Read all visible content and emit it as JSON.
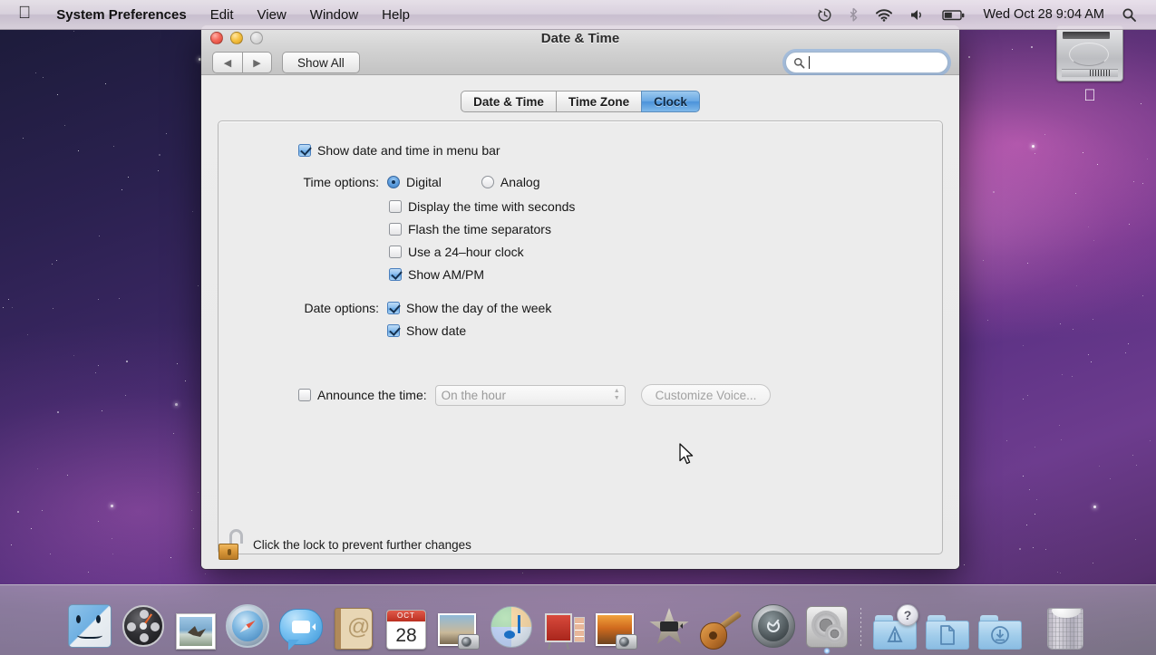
{
  "menubar": {
    "apple_icon": "apple-logo-icon",
    "items": [
      {
        "label": "System Preferences",
        "bold": true
      },
      {
        "label": "Edit",
        "bold": false
      },
      {
        "label": "View",
        "bold": false
      },
      {
        "label": "Window",
        "bold": false
      },
      {
        "label": "Help",
        "bold": false
      }
    ],
    "status_icons": [
      "time-machine-icon",
      "bluetooth-icon",
      "wifi-icon",
      "volume-icon",
      "battery-icon"
    ],
    "clock": "Wed Oct 28  9:04 AM",
    "spotlight_icon": "search-icon"
  },
  "desktop": {
    "hard_drive": {
      "name": "hard-drive-icon",
      "label": ""
    }
  },
  "window": {
    "title": "Date & Time",
    "traffic_lights": [
      "close-button",
      "minimize-button",
      "zoom-button"
    ],
    "toolbar": {
      "back_glyph": "◀",
      "forward_glyph": "▶",
      "show_all_label": "Show All",
      "search_placeholder": "",
      "search_value": ""
    },
    "tabs": [
      {
        "label": "Date & Time",
        "selected": false
      },
      {
        "label": "Time Zone",
        "selected": false
      },
      {
        "label": "Clock",
        "selected": true
      }
    ],
    "content": {
      "show_in_menubar": {
        "label": "Show date and time in menu bar",
        "checked": true
      },
      "time_options_label": "Time options:",
      "time_mode": [
        {
          "label": "Digital",
          "selected": true
        },
        {
          "label": "Analog",
          "selected": false
        }
      ],
      "time_checkboxes": [
        {
          "label": "Display the time with seconds",
          "checked": false
        },
        {
          "label": "Flash the time separators",
          "checked": false
        },
        {
          "label": "Use a 24–hour clock",
          "checked": false
        },
        {
          "label": "Show AM/PM",
          "checked": true
        }
      ],
      "date_options_label": "Date options:",
      "date_checkboxes": [
        {
          "label": "Show the day of the week",
          "checked": true
        },
        {
          "label": "Show date",
          "checked": true
        }
      ],
      "announce": {
        "label": "Announce the time:",
        "checked": false,
        "popup_value": "On the hour",
        "customize_button": "Customize Voice..."
      }
    },
    "footer": {
      "lock_icon": "unlocked-padlock-icon",
      "lock_text": "Click the lock to prevent further changes"
    }
  },
  "dock": {
    "items": [
      {
        "name": "finder",
        "running": false
      },
      {
        "name": "dashboard",
        "running": false
      },
      {
        "name": "mail",
        "running": false
      },
      {
        "name": "safari",
        "running": false
      },
      {
        "name": "ichat",
        "running": false
      },
      {
        "name": "address-book",
        "running": false
      },
      {
        "name": "ical",
        "running": false,
        "month": "OCT",
        "day": "28"
      },
      {
        "name": "iphoto",
        "running": false
      },
      {
        "name": "itunes",
        "running": false
      },
      {
        "name": "keynote",
        "running": false
      },
      {
        "name": "iphoto-library",
        "running": false
      },
      {
        "name": "imovie",
        "running": false
      },
      {
        "name": "garageband",
        "running": false
      },
      {
        "name": "time-machine",
        "running": false
      },
      {
        "name": "system-preferences",
        "running": true
      }
    ],
    "stacks": [
      {
        "name": "applications-folder",
        "badge": "?"
      },
      {
        "name": "documents-folder",
        "badge": ""
      },
      {
        "name": "downloads-folder",
        "badge": ""
      }
    ],
    "trash": {
      "name": "trash",
      "label": ""
    }
  },
  "colors": {
    "accent_blue": "#4b93da",
    "checkbox_blue": "#6aabe7",
    "window_bg": "#ececec",
    "menubar_bg": "#e8e0ea"
  }
}
